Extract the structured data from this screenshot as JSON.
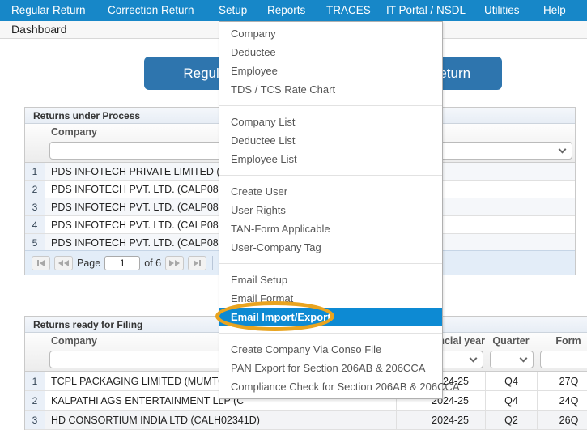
{
  "colors": {
    "menubar_bg": "#1787c8",
    "menu_highlight_bg": "#0d8ad3",
    "annotation_orange": "#e9a41f",
    "action_button_blue": "#2e75ae"
  },
  "menubar": {
    "items": [
      "Regular Return",
      "Correction Return",
      "Setup",
      "Reports",
      "TRACES",
      "IT Portal / NSDL",
      "Utilities",
      "Help"
    ]
  },
  "page": {
    "title": "Dashboard"
  },
  "actions": {
    "regular_return": "Regular Return",
    "correction_return": "Correction Return"
  },
  "setup_menu": {
    "groups": [
      [
        "Company",
        "Deductee",
        "Employee",
        "TDS / TCS Rate Chart"
      ],
      [
        "Company List",
        "Deductee List",
        "Employee List"
      ],
      [
        "Create User",
        "User Rights",
        "TAN-Form Applicable",
        "User-Company Tag"
      ],
      [
        "Email Setup",
        "Email Format",
        "Email Import/Export"
      ],
      [
        "Create Company Via Conso File",
        "PAN Export for Section 206AB & 206CCA",
        "Compliance Check for Section 206AB & 206CCA"
      ]
    ],
    "highlighted_item": "Email Import/Export"
  },
  "returns_under_process": {
    "title": "Returns under Process",
    "company_column": "Company",
    "rows": [
      {
        "no": "1",
        "company": "PDS INFOTECH PRIVATE LIMITED (DELS"
      },
      {
        "no": "2",
        "company": "PDS INFOTECH PVT. LTD. (CALP08143C"
      },
      {
        "no": "3",
        "company": "PDS INFOTECH PVT. LTD. (CALP08143C"
      },
      {
        "no": "4",
        "company": "PDS INFOTECH PVT. LTD. (CALP08143C"
      },
      {
        "no": "5",
        "company": "PDS INFOTECH PVT. LTD. (CALP08143C"
      }
    ],
    "pager": {
      "page_label": "Page",
      "page_value": "1",
      "of_label": "of 6",
      "page_size": "5"
    }
  },
  "returns_ready_for_filing": {
    "title": "Returns ready for Filing",
    "columns": {
      "company": "Company",
      "financial_year": "Financial year",
      "quarter": "Quarter",
      "form": "Form"
    },
    "rows": [
      {
        "no": "1",
        "company": "TCPL PACKAGING LIMITED (MUMT09495",
        "financial_year": "2024-25",
        "quarter": "Q4",
        "form": "27Q"
      },
      {
        "no": "2",
        "company": "KALPATHI AGS ENTERTAINMENT LLP (C",
        "financial_year": "2024-25",
        "quarter": "Q4",
        "form": "24Q"
      },
      {
        "no": "3",
        "company": "HD CONSORTIUM INDIA LTD (CALH02341D)",
        "financial_year": "2024-25",
        "quarter": "Q2",
        "form": "26Q"
      }
    ]
  }
}
